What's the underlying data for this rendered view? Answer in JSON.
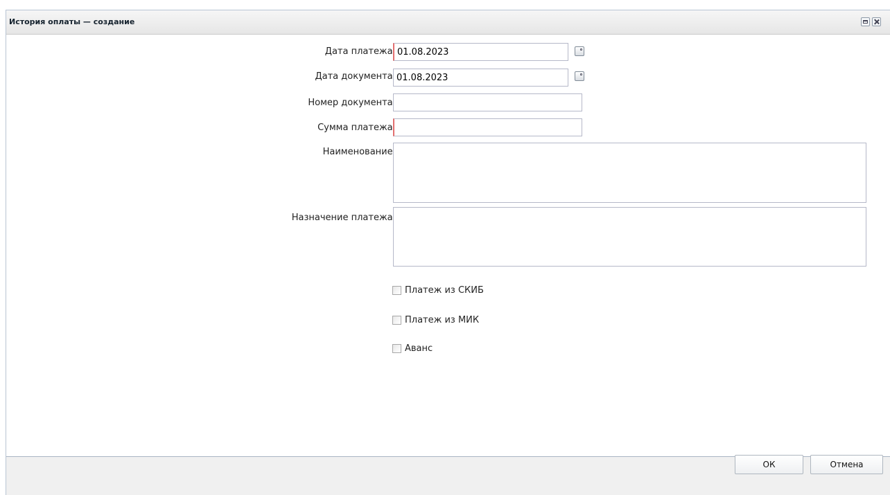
{
  "window": {
    "title": "История оплаты — создание",
    "maximize_icon": "maximize-icon",
    "close_icon": "close-icon"
  },
  "form": {
    "payment_date": {
      "label": "Дата платежа:",
      "value": "01.08.2023"
    },
    "document_date": {
      "label": "Дата документа:",
      "value": "01.08.2023"
    },
    "document_number": {
      "label": "Номер документа:",
      "value": ""
    },
    "payment_amount": {
      "label": "Сумма платежа:",
      "value": ""
    },
    "name": {
      "label": "Наименование:",
      "value": ""
    },
    "payment_purpose": {
      "label": "Назначение платежа:",
      "value": ""
    },
    "checkboxes": [
      {
        "label": "Платеж из СКИБ",
        "checked": false
      },
      {
        "label": "Платеж из МИК",
        "checked": false
      },
      {
        "label": "Аванс",
        "checked": false
      }
    ]
  },
  "buttons": {
    "ok": "ОК",
    "cancel": "Отмена"
  },
  "colors": {
    "required_marker": "#e36f6f",
    "field_border": "#b5b8c8",
    "title_text": "#15222e"
  }
}
